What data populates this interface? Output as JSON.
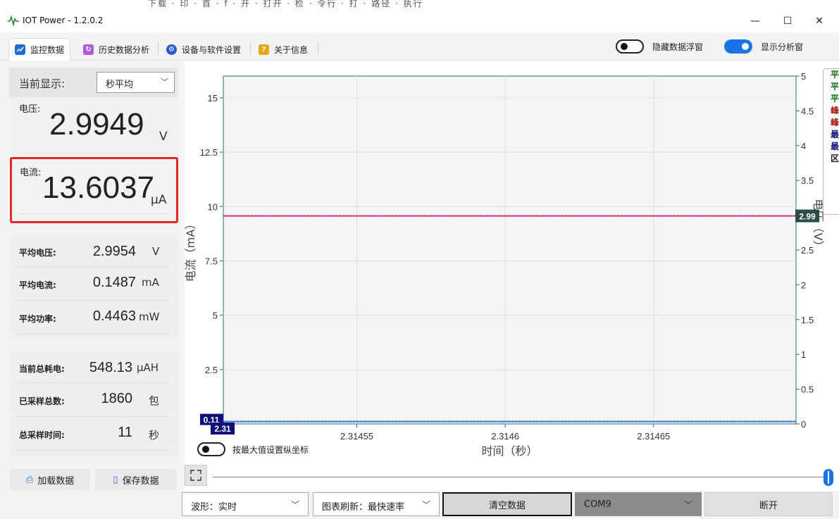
{
  "window": {
    "title": "IOT Power - 1.2.0.2",
    "background_ghost_text": "下载  ·  印  ·  首  ·  f  ·  开  ·  打开  ·  检  ·  令行  ·  打  ·  路径  ·  执行",
    "minimize": "—",
    "maximize": "☐",
    "close": "✕"
  },
  "tabs": [
    {
      "label": "监控数据",
      "icon": "chart-line-icon",
      "color": "#1f6fd6"
    },
    {
      "label": "历史数据分析",
      "icon": "history-icon",
      "color": "#b05ad8"
    },
    {
      "label": "设备与软件设置",
      "icon": "settings-icon",
      "color": "#2c58c9"
    },
    {
      "label": "关于信息",
      "icon": "help-icon",
      "color": "#e8a516"
    }
  ],
  "toggles": {
    "hide_float": {
      "label": "隐藏数据浮窗",
      "on": false
    },
    "show_analysis": {
      "label": "显示分析窗",
      "on": true
    },
    "max_axis": {
      "label": "按最大值设置纵坐标",
      "on": false
    }
  },
  "left": {
    "display_label": "当前显示:",
    "display_mode": "秒平均",
    "voltage_label": "电压:",
    "voltage_value": "2.9949",
    "voltage_unit": "V",
    "current_label": "电流:",
    "current_value": "13.6037",
    "current_unit": "μA",
    "stats1": [
      {
        "label": "平均电压:",
        "value": "2.9954",
        "unit": "V"
      },
      {
        "label": "平均电流:",
        "value": "0.1487",
        "unit": "mA"
      },
      {
        "label": "平均功率:",
        "value": "0.4463",
        "unit": "mW"
      }
    ],
    "stats2": [
      {
        "label": "当前总耗电:",
        "value": "548.13",
        "unit": "μAH"
      },
      {
        "label": "已采样总数:",
        "value": "1860",
        "unit": "包"
      },
      {
        "label": "总采样时间:",
        "value": "11",
        "unit": "秒"
      }
    ],
    "load_button": "加载数据",
    "save_button": "保存数据"
  },
  "legend_chars": [
    {
      "text": "平",
      "color": "#0a6b0a"
    },
    {
      "text": "平",
      "color": "#0a6b0a"
    },
    {
      "text": "平",
      "color": "#0a6b0a"
    },
    {
      "text": "峰",
      "color": "#b01010"
    },
    {
      "text": "峰",
      "color": "#b01010"
    },
    {
      "text": "最",
      "color": "#10107a"
    },
    {
      "text": "最",
      "color": "#10107a"
    },
    {
      "text": "区",
      "color": "#222222"
    }
  ],
  "bottom": {
    "waveform": "波形：实时",
    "refresh": "图表刷新：最快速率",
    "clear_button": "清空数据",
    "port": "COM9",
    "disconnect_button": "断开"
  },
  "chart_data": {
    "type": "line",
    "xlabel": "时间（秒）",
    "ylabel": "电流（mA）",
    "y2label": "电压（V）",
    "x_ticks": [
      "2.31455",
      "2.3146",
      "2.31465"
    ],
    "x_tick_values": [
      2.31455,
      2.3146,
      2.31465
    ],
    "xlim": [
      2.314505,
      2.314698
    ],
    "ylim": [
      0,
      16
    ],
    "y_ticks": [
      2.5,
      5,
      7.5,
      10,
      12.5,
      15
    ],
    "y2lim": [
      0,
      5
    ],
    "y2_ticks": [
      0,
      0.5,
      1,
      1.5,
      2,
      2.5,
      3,
      3.5,
      4,
      4.5,
      5
    ],
    "grid": true,
    "series": [
      {
        "name": "",
        "axis": "right",
        "color": "#d63a8a",
        "x": [
          2.314505,
          2.314698
        ],
        "y": [
          2.99,
          2.99
        ]
      },
      {
        "name": "",
        "axis": "left",
        "color": "#3a7fd6",
        "x": [
          2.314505,
          2.314698
        ],
        "y": [
          0.11,
          0.11
        ]
      }
    ],
    "markers": {
      "y2_label": "2.99",
      "y_label": "0.11",
      "x_label": "2.31"
    }
  }
}
